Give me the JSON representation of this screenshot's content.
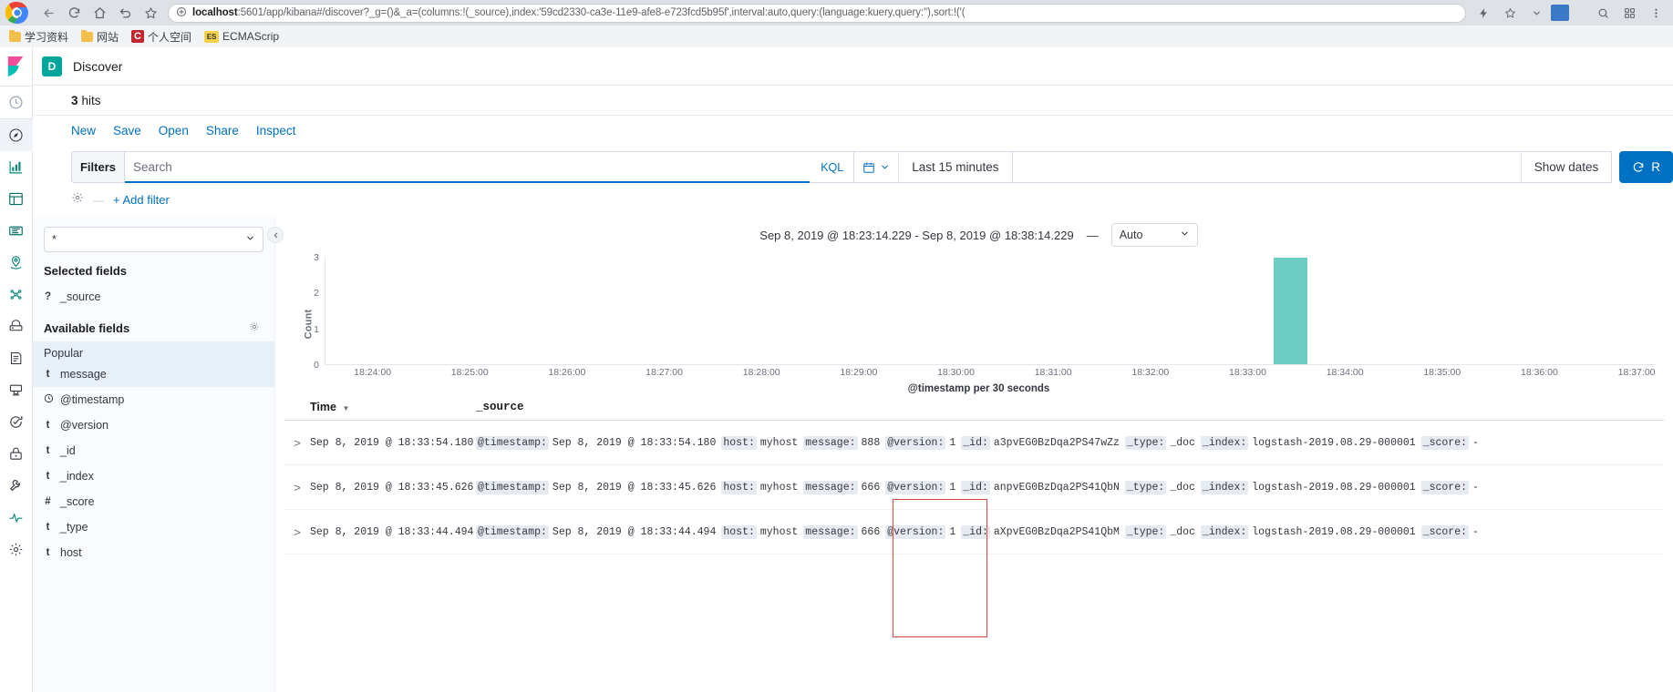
{
  "browser": {
    "nav_icons": [
      "back-icon",
      "forward-icon",
      "home-icon",
      "history-icon",
      "bookmark-star-icon"
    ],
    "url_host": "localhost",
    "url_rest": ":5601/app/kibana#/discover?_g=()&_a=(columns:!(_source),index:'59cd2330-ca3e-11e9-afe8-e723fcd5b95f',interval:auto,query:(language:kuery,query:''),sort:!('(",
    "bookmarks": [
      {
        "label": "学习资料",
        "icon": "folder-icon"
      },
      {
        "label": "网站",
        "icon": "folder-icon"
      },
      {
        "label": "个人空间",
        "icon": "csdn-icon"
      },
      {
        "label": "ECMAScrip",
        "icon": "ecmascript-icon"
      }
    ]
  },
  "rail": {
    "logo": "kibana-logo",
    "items": [
      {
        "name": "recently-viewed-icon"
      },
      {
        "name": "discover-icon",
        "active": true
      },
      {
        "name": "visualize-icon"
      },
      {
        "name": "dashboard-icon"
      },
      {
        "name": "canvas-icon"
      },
      {
        "name": "maps-icon"
      },
      {
        "name": "machine-learning-icon"
      },
      {
        "name": "infrastructure-icon"
      },
      {
        "name": "logs-icon"
      },
      {
        "name": "apm-icon"
      },
      {
        "name": "uptime-icon"
      },
      {
        "name": "siem-icon"
      },
      {
        "name": "dev-tools-icon"
      },
      {
        "name": "monitoring-icon"
      },
      {
        "name": "management-icon"
      }
    ]
  },
  "header": {
    "app_badge": "D",
    "title": "Discover"
  },
  "hits": {
    "count": "3",
    "label": "hits"
  },
  "menu": [
    {
      "label": "New",
      "name": "new-link"
    },
    {
      "label": "Save",
      "name": "save-link"
    },
    {
      "label": "Open",
      "name": "open-link"
    },
    {
      "label": "Share",
      "name": "share-link"
    },
    {
      "label": "Inspect",
      "name": "inspect-link"
    }
  ],
  "query_bar": {
    "filters_label": "Filters",
    "search_value": "",
    "search_placeholder": "Search",
    "kql_label": "KQL",
    "time_range": "Last 15 minutes",
    "show_dates": "Show dates",
    "update_label": "R"
  },
  "add_filter": {
    "label": "+ Add filter"
  },
  "sidebar": {
    "index_pattern": "*",
    "selected_fields_title": "Selected fields",
    "selected_fields": [
      {
        "type": "?",
        "label": "_source"
      }
    ],
    "available_fields_title": "Available fields",
    "popular_label": "Popular",
    "popular_fields": [
      {
        "type": "t",
        "label": "message"
      }
    ],
    "available_fields": [
      {
        "type": "clock",
        "label": "@timestamp"
      },
      {
        "type": "t",
        "label": "@version"
      },
      {
        "type": "t",
        "label": "_id"
      },
      {
        "type": "t",
        "label": "_index"
      },
      {
        "type": "#",
        "label": "_score"
      },
      {
        "type": "t",
        "label": "_type"
      },
      {
        "type": "t",
        "label": "host"
      }
    ]
  },
  "chart_header": {
    "range_text": "Sep 8, 2019 @ 18:23:14.229 - Sep 8, 2019 @ 18:38:14.229",
    "dash": "—",
    "interval": "Auto"
  },
  "chart_data": {
    "type": "bar",
    "title": "",
    "xlabel": "@timestamp per 30 seconds",
    "ylabel": "Count",
    "ylim": [
      0,
      3
    ],
    "yticks": [
      0,
      1,
      2,
      3
    ],
    "xticks": [
      "18:24:00",
      "18:25:00",
      "18:26:00",
      "18:27:00",
      "18:28:00",
      "18:29:00",
      "18:30:00",
      "18:31:00",
      "18:32:00",
      "18:33:00",
      "18:34:00",
      "18:35:00",
      "18:36:00",
      "18:37:00"
    ],
    "bar_color": "#6dccc4",
    "categories": [
      "18:33:30"
    ],
    "values": [
      3
    ],
    "grid": false,
    "legend": "none"
  },
  "doc_table": {
    "columns": [
      {
        "label": "Time",
        "name": "column-time",
        "sorted": true
      },
      {
        "label": "_source",
        "name": "column-source"
      }
    ],
    "rows": [
      {
        "time": "Sep 8, 2019 @ 18:33:54.180",
        "fields": [
          {
            "k": "@timestamp:",
            "v": "Sep 8, 2019 @ 18:33:54.180"
          },
          {
            "k": "host:",
            "v": "myhost"
          },
          {
            "k": "message:",
            "v": "888"
          },
          {
            "k": "@version:",
            "v": "1"
          },
          {
            "k": "_id:",
            "v": "a3pvEG0BzDqa2PS47wZz"
          },
          {
            "k": "_type:",
            "v": "_doc"
          },
          {
            "k": "_index:",
            "v": "logstash-2019.08.29-000001"
          },
          {
            "k": "_score:",
            "v": "-"
          }
        ]
      },
      {
        "time": "Sep 8, 2019 @ 18:33:45.626",
        "fields": [
          {
            "k": "@timestamp:",
            "v": "Sep 8, 2019 @ 18:33:45.626"
          },
          {
            "k": "host:",
            "v": "myhost"
          },
          {
            "k": "message:",
            "v": "666"
          },
          {
            "k": "@version:",
            "v": "1"
          },
          {
            "k": "_id:",
            "v": "anpvEG0BzDqa2PS41QbN"
          },
          {
            "k": "_type:",
            "v": "_doc"
          },
          {
            "k": "_index:",
            "v": "logstash-2019.08.29-000001"
          },
          {
            "k": "_score:",
            "v": "-"
          }
        ]
      },
      {
        "time": "Sep 8, 2019 @ 18:33:44.494",
        "fields": [
          {
            "k": "@timestamp:",
            "v": "Sep 8, 2019 @ 18:33:44.494"
          },
          {
            "k": "host:",
            "v": "myhost"
          },
          {
            "k": "message:",
            "v": "666"
          },
          {
            "k": "@version:",
            "v": "1"
          },
          {
            "k": "_id:",
            "v": "aXpvEG0BzDqa2PS41QbM"
          },
          {
            "k": "_type:",
            "v": "_doc"
          },
          {
            "k": "_index:",
            "v": "logstash-2019.08.29-000001"
          },
          {
            "k": "_score:",
            "v": "-"
          }
        ]
      }
    ]
  },
  "annotation": {
    "color": "#e0443e",
    "name": "message-column-highlight"
  }
}
